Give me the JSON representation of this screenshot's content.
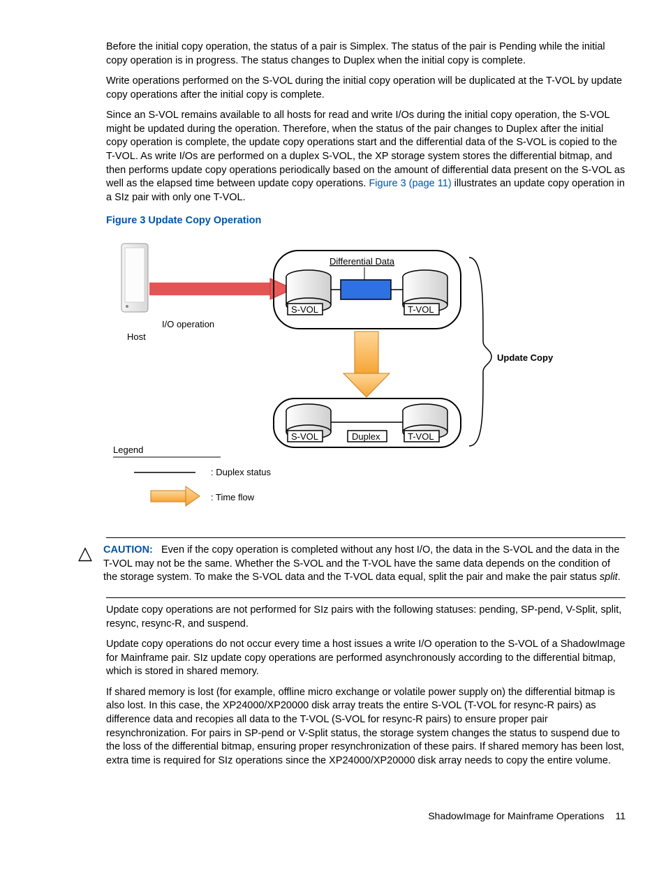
{
  "paragraphs": {
    "p1": "Before the initial copy operation, the status of a pair is Simplex. The status of the pair is Pending while the initial copy operation is in progress. The status changes to Duplex when the initial copy is complete.",
    "p2": "Write operations performed on the S-VOL during the initial copy operation will be duplicated at the T-VOL by update copy operations after the initial copy is complete.",
    "p3a": "Since an S-VOL remains available to all hosts for read and write I/Os during the initial copy operation, the S-VOL might be updated during the operation. Therefore, when the status of the pair changes to Duplex after the initial copy operation is complete, the update copy operations start and the differential data of the S-VOL is copied to the T-VOL. As write I/Os are performed on a duplex S-VOL, the XP storage system stores the differential bitmap, and then performs update copy operations periodically based on the amount of differential data present on the S-VOL as well as the elapsed time between update copy operations. ",
    "p3link": "Figure 3 (page 11)",
    "p3b": " illustrates an update copy operation in a SIz pair with only one T-VOL.",
    "figure_title": "Figure 3 Update Copy Operation",
    "caution_label": "CAUTION:",
    "caution_body_a": "Even if the copy operation is completed without any host I/O, the data in the S-VOL and the data in the T-VOL may not be the same. Whether the S-VOL and the T-VOL have the same data depends on the condition of the storage system. To make the S-VOL data and the T-VOL data equal, split the pair and make the pair status ",
    "caution_body_italic": "split",
    "caution_body_b": ".",
    "p4": "Update copy operations are not performed for SIz pairs with the following statuses: pending, SP-pend, V-Split, split, resync, resync-R, and suspend.",
    "p5": "Update copy operations do not occur every time a host issues a write I/O operation to the S-VOL of a ShadowImage for Mainframe pair. SIz update copy operations are performed asynchronously according to the differential bitmap, which is stored in shared memory.",
    "p6": "If shared memory is lost (for example, offline micro exchange or volatile power supply on) the differential bitmap is also lost. In this case, the XP24000/XP20000 disk array treats the entire S-VOL (T-VOL for resync-R pairs) as difference data and recopies all data to the T-VOL (S-VOL for resync-R pairs) to ensure proper pair resynchronization. For pairs in SP-pend or V-Split status, the storage system changes the status to suspend due to the loss of the differential bitmap, ensuring proper resynchronization of these pairs. If shared memory has been lost, extra time is required for SIz operations since the XP24000/XP20000 disk array needs to copy the entire volume."
  },
  "diagram": {
    "host": "Host",
    "io_operation": "I/O operation",
    "differential_data": "Differential Data",
    "svol": "S-VOL",
    "tvol": "T-VOL",
    "duplex": "Duplex",
    "update_copy": "Update Copy",
    "legend": "Legend",
    "legend_duplex": ": Duplex status",
    "legend_timeflow": ": Time flow"
  },
  "footer": {
    "section": "ShadowImage for Mainframe Operations",
    "page": "11"
  }
}
